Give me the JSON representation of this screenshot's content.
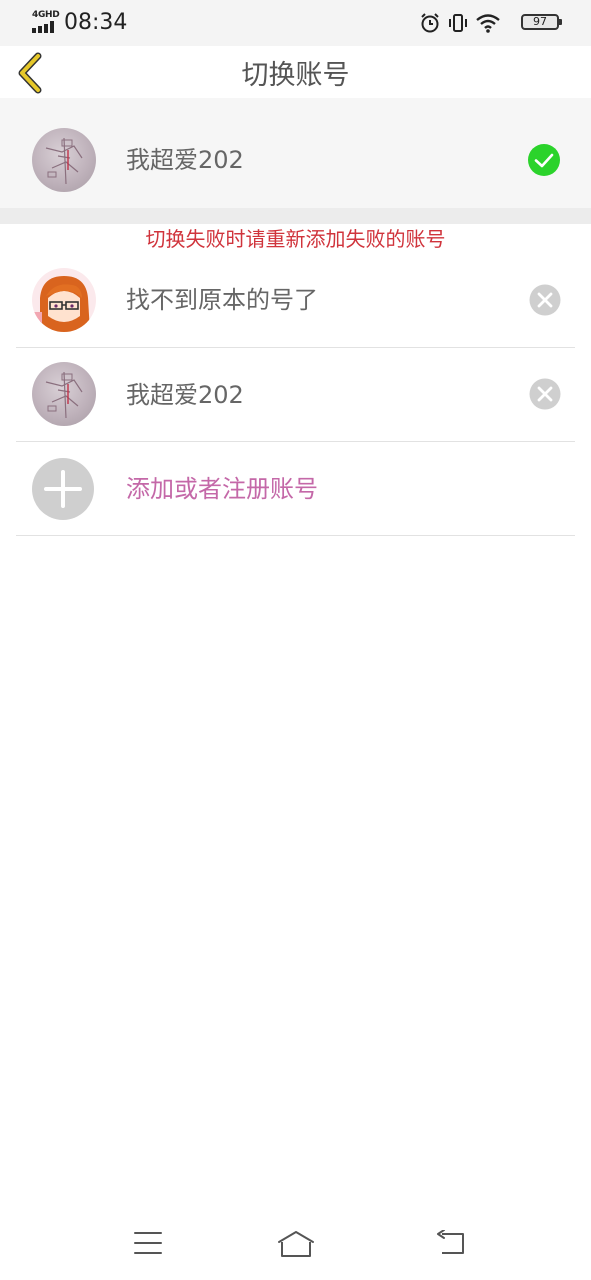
{
  "status_bar": {
    "network": "4GHD",
    "time": "08:34",
    "battery": "97",
    "icons": [
      "signal-icon",
      "alarm-icon",
      "vibrate-icon",
      "wifi-icon",
      "battery-icon"
    ]
  },
  "header": {
    "title": "切换账号",
    "back_icon": "chevron-left-icon",
    "accent_color": "#e6c82a"
  },
  "current_account": {
    "name": "我超爱202",
    "avatar": "avatar-map-photo",
    "status_icon": "check-circle-icon",
    "status_color": "#2bd32b"
  },
  "notice": {
    "text": "切换失败时请重新添加失败的账号",
    "color": "#d0343c"
  },
  "accounts": [
    {
      "name": "找不到原本的号了",
      "avatar": "avatar-anime-girl",
      "action_icon": "remove-icon"
    },
    {
      "name": "我超爱202",
      "avatar": "avatar-map-photo",
      "action_icon": "remove-icon"
    }
  ],
  "add_account": {
    "label": "添加或者注册账号",
    "icon": "plus-icon",
    "label_color": "#c468a8"
  },
  "nav_bar": {
    "items": [
      "menu-icon",
      "home-icon",
      "back-icon"
    ]
  }
}
